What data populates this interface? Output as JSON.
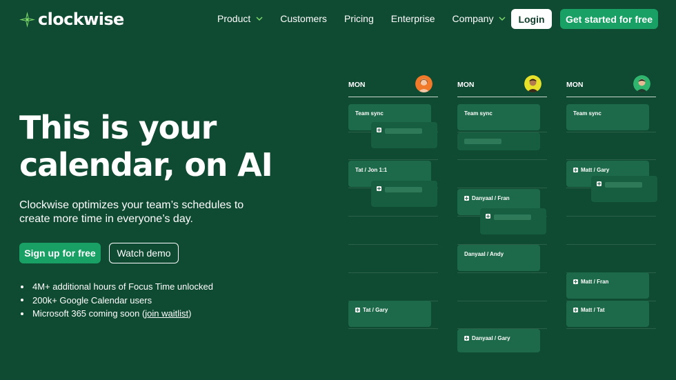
{
  "brand": {
    "name": "clockwise",
    "icon": "clockwise-logo-icon",
    "accent": "#19a065",
    "background": "#0f4a32"
  },
  "nav": {
    "items": [
      {
        "label": "Product",
        "has_dropdown": true
      },
      {
        "label": "Customers",
        "has_dropdown": false
      },
      {
        "label": "Pricing",
        "has_dropdown": false
      },
      {
        "label": "Enterprise",
        "has_dropdown": false
      },
      {
        "label": "Company",
        "has_dropdown": true
      }
    ],
    "login_label": "Login",
    "cta_label": "Get started for free"
  },
  "hero": {
    "title_line1": "This is your",
    "title_line2": "calendar, on AI",
    "subtitle": "Clockwise optimizes your team’s schedules to create more time in everyone’s day.",
    "primary_button": "Sign up for free",
    "secondary_button": "Watch demo",
    "bullets": [
      "4M+ additional hours of Focus Time unlocked",
      "200k+ Google Calendar users"
    ],
    "bullet3_prefix": "Microsoft 365 coming soon (",
    "bullet3_link": "join waitlist",
    "bullet3_suffix": ")"
  },
  "calendar": {
    "columns": [
      {
        "day": "MON",
        "avatar_icon": "person-avatar-orange-icon",
        "events": [
          {
            "label": "Team sync",
            "has_plus": false
          },
          {
            "label": "Tat / Jon 1:1",
            "has_plus": false
          },
          {
            "label": "Tat / Gary",
            "has_plus": true
          }
        ]
      },
      {
        "day": "MON",
        "avatar_icon": "person-avatar-yellow-icon",
        "events": [
          {
            "label": "Team sync",
            "has_plus": false
          },
          {
            "label": "Danyaal / Fran",
            "has_plus": true
          },
          {
            "label": "Danyaal / Andy",
            "has_plus": false
          },
          {
            "label": "Danyaal / Gary",
            "has_plus": true
          }
        ]
      },
      {
        "day": "MON",
        "avatar_icon": "person-avatar-green-icon",
        "events": [
          {
            "label": "Team sync",
            "has_plus": false
          },
          {
            "label": "Matt / Gary",
            "has_plus": true
          },
          {
            "label": "Matt / Fran",
            "has_plus": true
          },
          {
            "label": "Matt / Tat",
            "has_plus": true
          }
        ]
      }
    ]
  }
}
